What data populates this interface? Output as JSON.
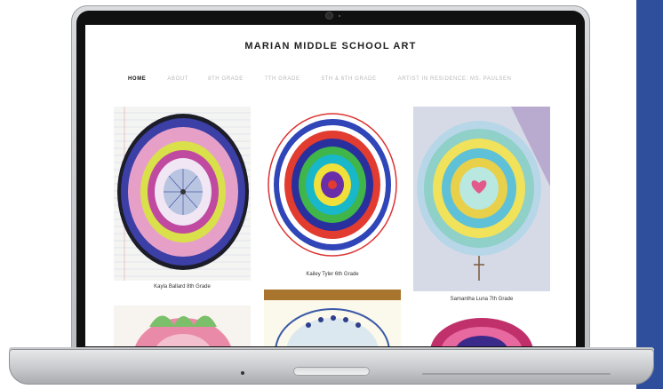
{
  "site": {
    "title": "MARIAN MIDDLE SCHOOL ART"
  },
  "nav": {
    "items": [
      {
        "label": "HOME",
        "active": true
      },
      {
        "label": "ABOUT",
        "active": false
      },
      {
        "label": "8TH GRADE",
        "active": false
      },
      {
        "label": "7TH GRADE",
        "active": false
      },
      {
        "label": "5TH & 6TH GRADE",
        "active": false
      },
      {
        "label": "ARTIST IN RESIDENCE: MS. PAULSEN",
        "active": false
      }
    ]
  },
  "gallery": {
    "captions": [
      "Kayla Ballard 8th Grade",
      "Kailey Tyler 6th Grade",
      "Samantha Luna 7th Grade"
    ]
  },
  "colors": {
    "side_panel": "#2f4f9c",
    "nav_active": "#111111",
    "nav_inactive": "#b9b9b9"
  }
}
